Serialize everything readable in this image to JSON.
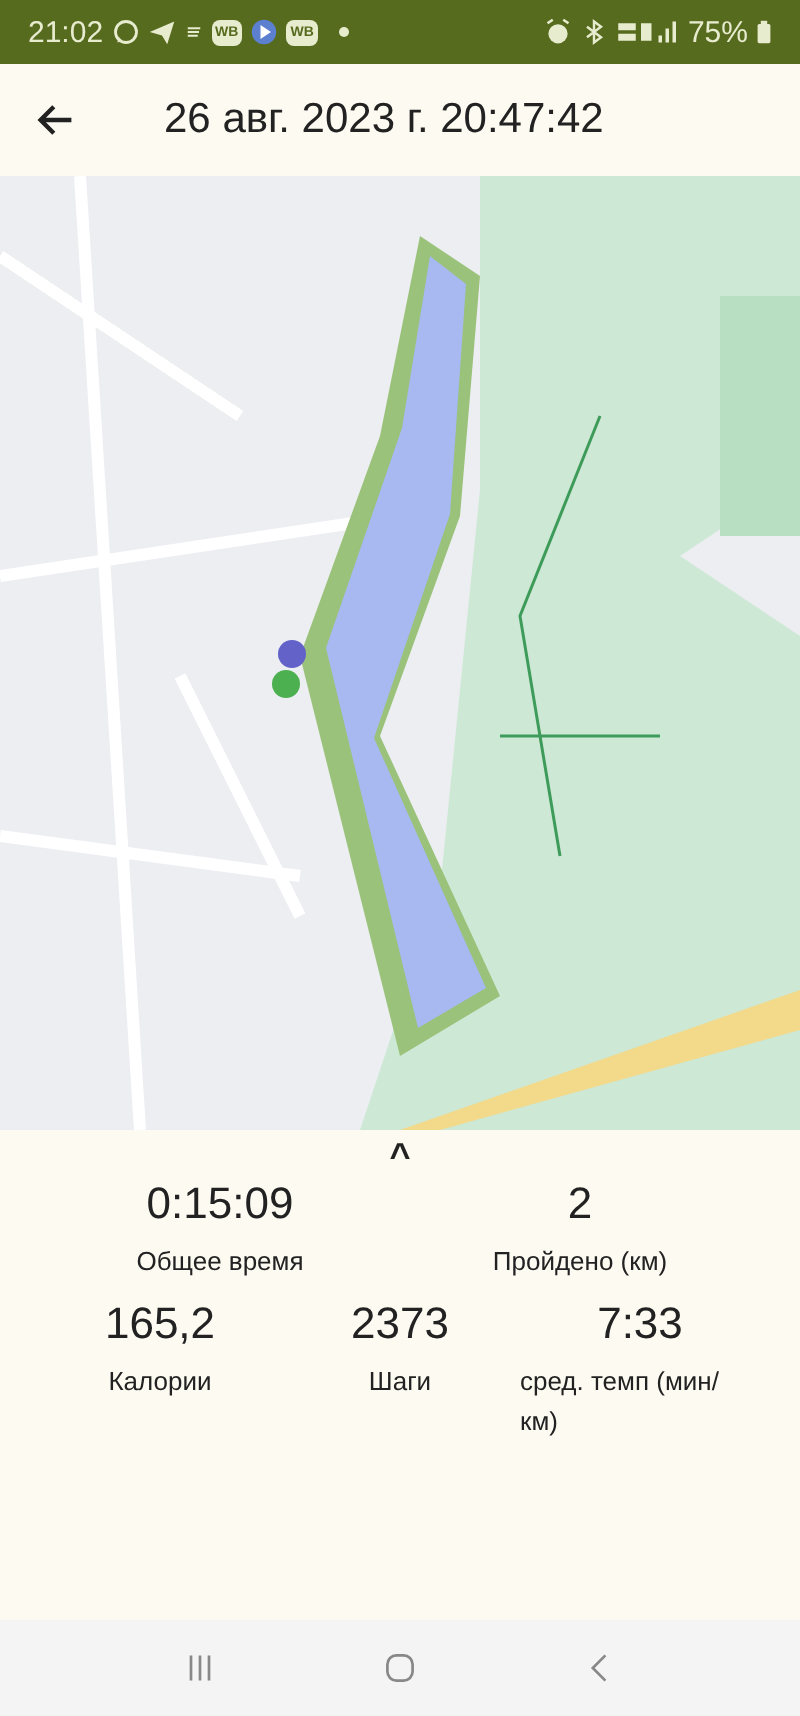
{
  "status_bar": {
    "time": "21:02",
    "badges": [
      "WB",
      "WB"
    ],
    "battery": "75%"
  },
  "header": {
    "title": "26 авг. 2023 г. 20:47:42"
  },
  "map": {
    "kind": "picture"
  },
  "panel": {
    "expander": "^"
  },
  "stats": [
    [
      {
        "value": "0:15:09",
        "label": "Общее время"
      },
      {
        "value": "2",
        "label": "Пройдено (км)"
      }
    ],
    [
      {
        "value": "165,2",
        "label": "Калории"
      },
      {
        "value": "2373",
        "label": "Шаги"
      },
      {
        "value": "7:33",
        "label": "сред. темп (мин/ км)"
      }
    ]
  ]
}
